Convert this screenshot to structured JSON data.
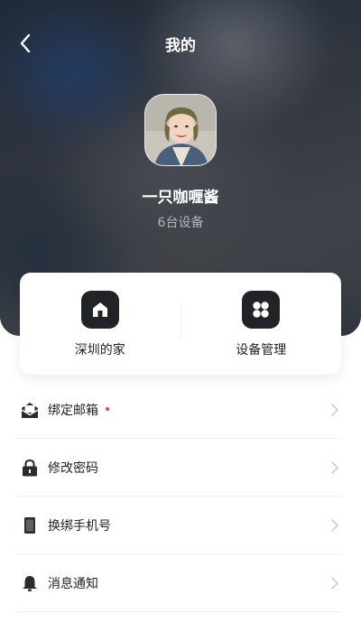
{
  "header": {
    "title": "我的"
  },
  "profile": {
    "name": "一只咖喱酱",
    "device_count": "6台设备"
  },
  "shortcuts": [
    {
      "label": "深圳的家",
      "icon": "home-icon"
    },
    {
      "label": "设备管理",
      "icon": "grid-icon"
    }
  ],
  "menu": [
    {
      "label": "绑定邮箱",
      "icon": "mail-icon",
      "has_badge": true
    },
    {
      "label": "修改密码",
      "icon": "lock-icon",
      "has_badge": false
    },
    {
      "label": "换绑手机号",
      "icon": "phone-icon",
      "has_badge": false
    },
    {
      "label": "消息通知",
      "icon": "bell-icon",
      "has_badge": false
    }
  ],
  "colors": {
    "badge": "#e8415a",
    "icon_dark": "#222326"
  }
}
